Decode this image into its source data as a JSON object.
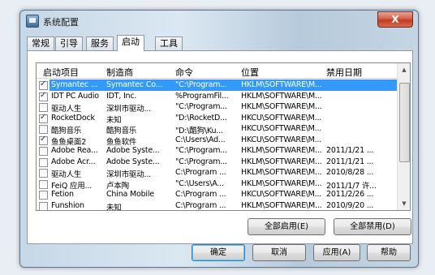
{
  "window": {
    "title": "系统配置",
    "close_label": "X"
  },
  "tabs": [
    "常规",
    "引导",
    "服务",
    "启动",
    "工具"
  ],
  "columns": [
    "启动项目",
    "制造商",
    "命令",
    "位置",
    "禁用日期"
  ],
  "rows": [
    {
      "checked": true,
      "selected": true,
      "name": "Symantec ...",
      "maker": "Symantec Co...",
      "command": "\"C:\\Program...",
      "location": "HKLM\\SOFTWARE\\M...",
      "date": ""
    },
    {
      "checked": true,
      "selected": false,
      "name": "IDT PC Audio",
      "maker": "IDT, Inc.",
      "command": "%ProgramFil...",
      "location": "HKLM\\SOFTWARE\\M...",
      "date": ""
    },
    {
      "checked": false,
      "selected": false,
      "name": "驱动人生",
      "maker": "深圳市驱动...",
      "command": "\"C:\\Program...",
      "location": "HKLM\\SOFTWARE\\M...",
      "date": ""
    },
    {
      "checked": true,
      "selected": false,
      "name": "RocketDock",
      "maker": "未知",
      "command": "\"D:\\RocketD...",
      "location": "HKCU\\SOFTWARE\\M...",
      "date": ""
    },
    {
      "checked": false,
      "selected": false,
      "name": "酷狗音乐",
      "maker": "酷狗音乐",
      "command": "\"D:\\酷狗\\Ku...",
      "location": "HKCU\\SOFTWARE\\M...",
      "date": ""
    },
    {
      "checked": true,
      "selected": false,
      "name": "鱼鱼桌面2",
      "maker": "鱼鱼软件",
      "command": "C:\\Users\\Ad...",
      "location": "HKCU\\SOFTWARE\\M...",
      "date": ""
    },
    {
      "checked": false,
      "selected": false,
      "name": "Adobe Rea...",
      "maker": "Adobe Syste...",
      "command": "\"C:\\Program...",
      "location": "HKLM\\SOFTWARE\\M...",
      "date": "2011/1/21 ..."
    },
    {
      "checked": false,
      "selected": false,
      "name": "Adobe Acr...",
      "maker": "Adobe Syste...",
      "command": "\"C:\\Program...",
      "location": "HKLM\\SOFTWARE\\M...",
      "date": "2011/1/21 ..."
    },
    {
      "checked": false,
      "selected": false,
      "name": "驱动人生",
      "maker": "深圳市驱动...",
      "command": "C:\\Program ...",
      "location": "HKLM\\SOFTWARE\\M...",
      "date": "2010/8/28 ..."
    },
    {
      "checked": false,
      "selected": false,
      "name": "FeiQ 应用...",
      "maker": "卢本陶",
      "command": "\"C:\\Users\\A...",
      "location": "HKLM\\SOFTWARE\\M...",
      "date": "2011/1/7 许..."
    },
    {
      "checked": false,
      "selected": false,
      "name": "Fetion",
      "maker": "China Mobile",
      "command": "C:\\Program ...",
      "location": "HKCU\\SOFTWARE\\M...",
      "date": "2011/2/26 ..."
    },
    {
      "checked": false,
      "selected": false,
      "name": "Funshion",
      "maker": "未知",
      "command": "C:\\Program ...",
      "location": "HKLM\\SOFTWARE\\M...",
      "date": "2010/9/20 ..."
    }
  ],
  "actions": {
    "enable_all": "全部启用(E)",
    "disable_all": "全部禁用(D)"
  },
  "footer": {
    "ok": "确定",
    "cancel": "取消",
    "apply": "应用(A)",
    "help": "帮助"
  },
  "icons": [
    "app-icon",
    "checkbox-icon",
    "scroll-up-icon",
    "scroll-down-icon"
  ]
}
